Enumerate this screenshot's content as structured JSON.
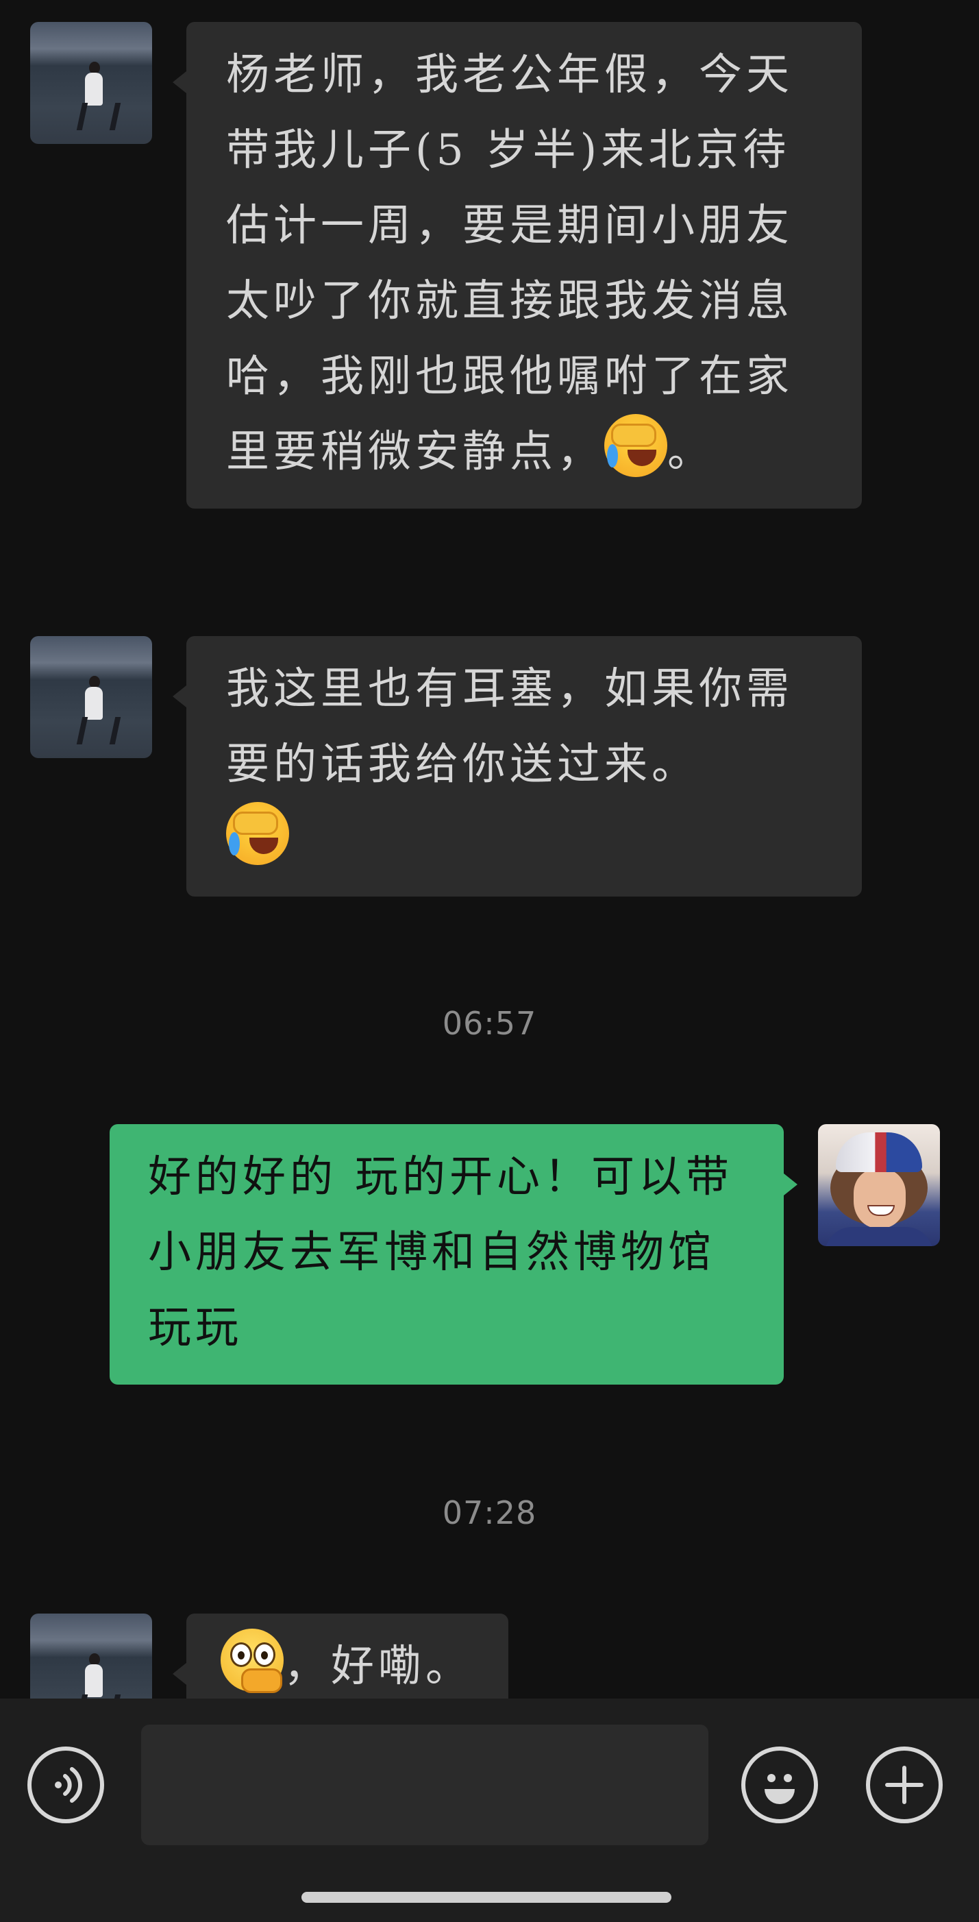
{
  "messages": [
    {
      "side": "left",
      "sender": "contact",
      "text": "杨老师，我老公年假，今天带我儿子(5 岁半)来北京待估计一周，要是期间小朋友太吵了你就直接跟我发消息哈，我刚也跟他嘱咐了在家里要稍微安静点，",
      "emoji": "loudly-crying-facepalm-emoji",
      "suffix": "。"
    },
    {
      "side": "left",
      "sender": "contact",
      "text": "我这里也有耳塞，如果你需要的话我给你送过来。",
      "emoji": "loudly-crying-facepalm-emoji"
    },
    {
      "type": "timestamp",
      "text": "06:57"
    },
    {
      "side": "right",
      "sender": "me",
      "text": "好的好的 玩的开心！可以带小朋友去军博和自然博物馆玩玩"
    },
    {
      "type": "timestamp",
      "text": "07:28"
    },
    {
      "side": "left",
      "sender": "contact",
      "emoji": "thinking-face-emoji",
      "text": "，好嘞。"
    }
  ],
  "input_bar": {
    "voice_icon": "voice-icon",
    "emoji_icon": "smiley-icon",
    "more_icon": "plus-icon",
    "input_value": ""
  },
  "colors": {
    "background": "#111111",
    "incoming_bubble": "#2c2c2c",
    "outgoing_bubble": "#3fb572",
    "incoming_text": "#d6d6d6",
    "outgoing_text": "#101010",
    "timestamp_text": "#8c8c8c",
    "input_bar": "#1e1e1e"
  }
}
